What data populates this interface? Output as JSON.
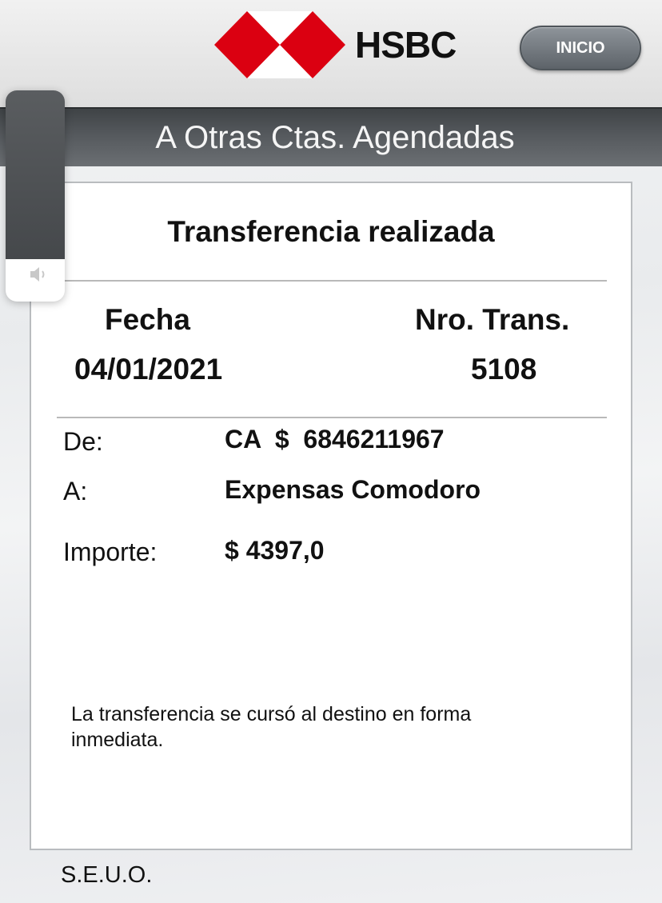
{
  "header": {
    "brand": "HSBC",
    "inicio_label": "INICIO"
  },
  "title_bar": {
    "title": "A Otras Ctas. Agendadas"
  },
  "receipt": {
    "title": "Transferencia realizada",
    "fecha_label": "Fecha",
    "fecha_value": "04/01/2021",
    "nro_label": "Nro. Trans.",
    "nro_value": "5108",
    "de_label": "De:",
    "de_value": "CA  $  6846211967",
    "a_label": "A:",
    "a_value": "Expensas Comodoro",
    "importe_label": "Importe:",
    "importe_value": "$ 4397,0",
    "note": "La transferencia se cursó al destino en forma inmediata."
  },
  "footer": {
    "seuo": "S.E.U.O."
  },
  "volume_hud": {
    "icon": "speaker-icon",
    "level": 0.8
  },
  "colors": {
    "brand_red": "#db0011",
    "title_bar": "#505457",
    "button_gray": "#6f757b"
  }
}
